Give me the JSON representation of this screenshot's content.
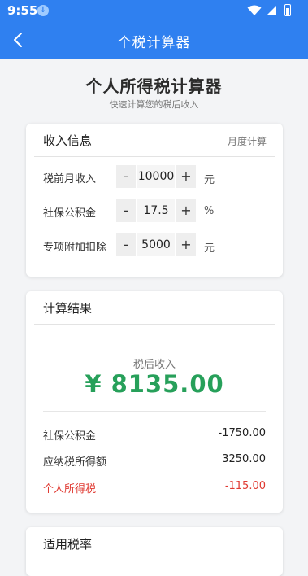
{
  "status_bar": {
    "time": "9:55"
  },
  "nav": {
    "title": "个税计算器"
  },
  "hero": {
    "title": "个人所得税计算器",
    "subtitle": "快速计算您的税后收入"
  },
  "income_card": {
    "title": "收入信息",
    "mode": "月度计算",
    "rows": [
      {
        "label": "税前月收入",
        "minus": "-",
        "value": "10000",
        "plus": "+",
        "unit": "元"
      },
      {
        "label": "社保公积金",
        "minus": "-",
        "value": "17.5",
        "plus": "+",
        "unit": "%"
      },
      {
        "label": "专项附加扣除",
        "minus": "-",
        "value": "5000",
        "plus": "+",
        "unit": "元"
      }
    ]
  },
  "result_card": {
    "title": "计算结果",
    "net_label": "税后收入",
    "net_value": "¥ 8135.00",
    "rows": [
      {
        "label": "社保公积金",
        "value": "-1750.00"
      },
      {
        "label": "应纳税所得额",
        "value": "3250.00"
      },
      {
        "label": "个人所得税",
        "value": "-115.00"
      }
    ],
    "tax_color": "#e03a32",
    "net_color": "#27a05a"
  },
  "rate_card": {
    "title": "适用税率"
  },
  "theme": {
    "primary": "#2f80f0"
  }
}
